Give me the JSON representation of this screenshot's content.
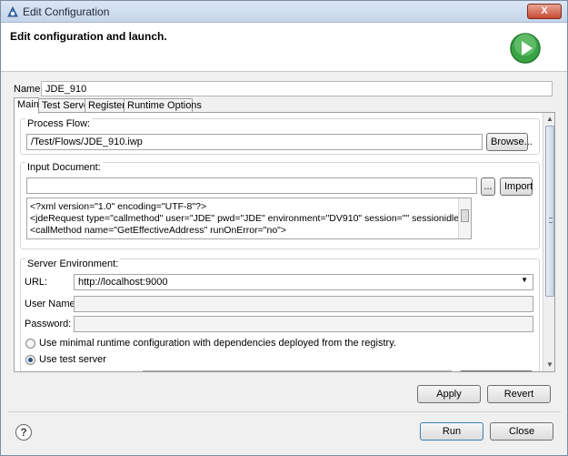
{
  "window": {
    "title": "Edit Configuration",
    "close_label": "X"
  },
  "header": {
    "heading": "Edit configuration and launch."
  },
  "name": {
    "label": "Name:",
    "value": "JDE_910"
  },
  "tabs": [
    {
      "label": "Main"
    },
    {
      "label": "Test Server"
    },
    {
      "label": "Registers"
    },
    {
      "label": "Runtime Options"
    }
  ],
  "process_flow": {
    "group_label": "Process Flow:",
    "value": "/Test/Flows/JDE_910.iwp",
    "browse_label": "Browse..."
  },
  "input_document": {
    "group_label": "Input Document:",
    "value": "",
    "more_label": "...",
    "import_label": "Import",
    "xml_lines": [
      "<?xml version=\"1.0\" encoding=\"UTF-8\"?>",
      "<jdeRequest  type=\"callmethod\" user=\"JDE\" pwd=\"JDE\" environment=\"DV910\" session=\"\" sessionidle=\"\">",
      "<callMethod name=\"GetEffectiveAddress\" runOnError=\"no\">"
    ]
  },
  "server_env": {
    "group_label": "Server Environment:",
    "url_label": "URL:",
    "url_value": "http://localhost:9000",
    "username_label": "User Name:",
    "username_value": "",
    "password_label": "Password:",
    "password_value": "",
    "radio_minimal_label": "Use minimal runtime configuration with dependencies deployed from the registry.",
    "radio_test_label": "Use test server"
  },
  "buttons": {
    "apply": "Apply",
    "revert": "Revert",
    "run": "Run",
    "close": "Close",
    "help": "?"
  },
  "colors": {
    "run_icon": "#3aa346",
    "title_bar": "#c5d5ea"
  }
}
